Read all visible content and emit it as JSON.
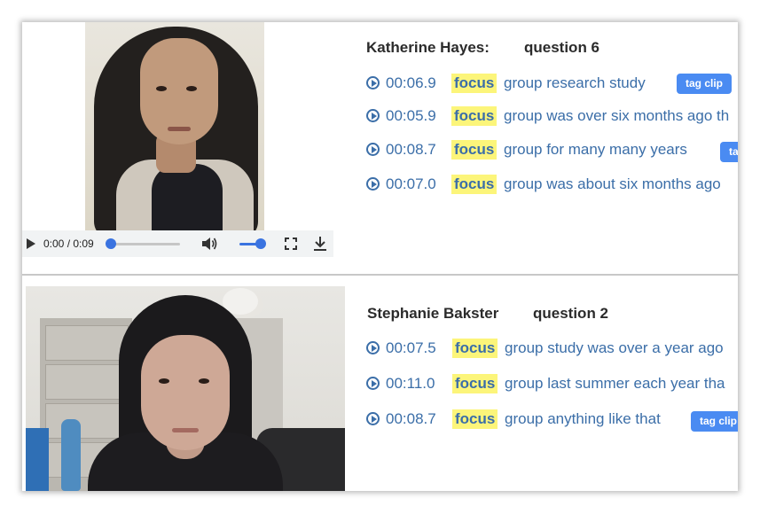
{
  "clips": [
    {
      "name": "Katherine Hayes:",
      "question": "question 6",
      "player": {
        "time": "0:00 / 0:09",
        "progress": 0,
        "volume": 1.0
      },
      "results": [
        {
          "timestamp": "00:06.9",
          "keyword": "focus",
          "snippet": "group research study",
          "tag_label": "tag clip"
        },
        {
          "timestamp": "00:05.9",
          "keyword": "focus",
          "snippet": "group was over six months ago th"
        },
        {
          "timestamp": "00:08.7",
          "keyword": "focus",
          "snippet": "group for many many years",
          "tag_label": "ta"
        },
        {
          "timestamp": "00:07.0",
          "keyword": "focus",
          "snippet": "group was about six months ago"
        }
      ]
    },
    {
      "name": "Stephanie Bakster",
      "question": "question 2",
      "results": [
        {
          "timestamp": "00:07.5",
          "keyword": "focus",
          "snippet": "group study was over a year ago"
        },
        {
          "timestamp": "00:11.0",
          "keyword": "focus",
          "snippet": "group last summer each year tha"
        },
        {
          "timestamp": "00:08.7",
          "keyword": "focus",
          "snippet": "group anything like that",
          "tag_label": "tag clip"
        }
      ]
    }
  ],
  "colors": {
    "link": "#3b6ea8",
    "highlight": "#fcf57a",
    "button": "#4a8bf2",
    "slider": "#3a73e0"
  },
  "icons": [
    "play-icon",
    "volume-icon",
    "fullscreen-icon",
    "download-icon",
    "play-circle-icon"
  ]
}
